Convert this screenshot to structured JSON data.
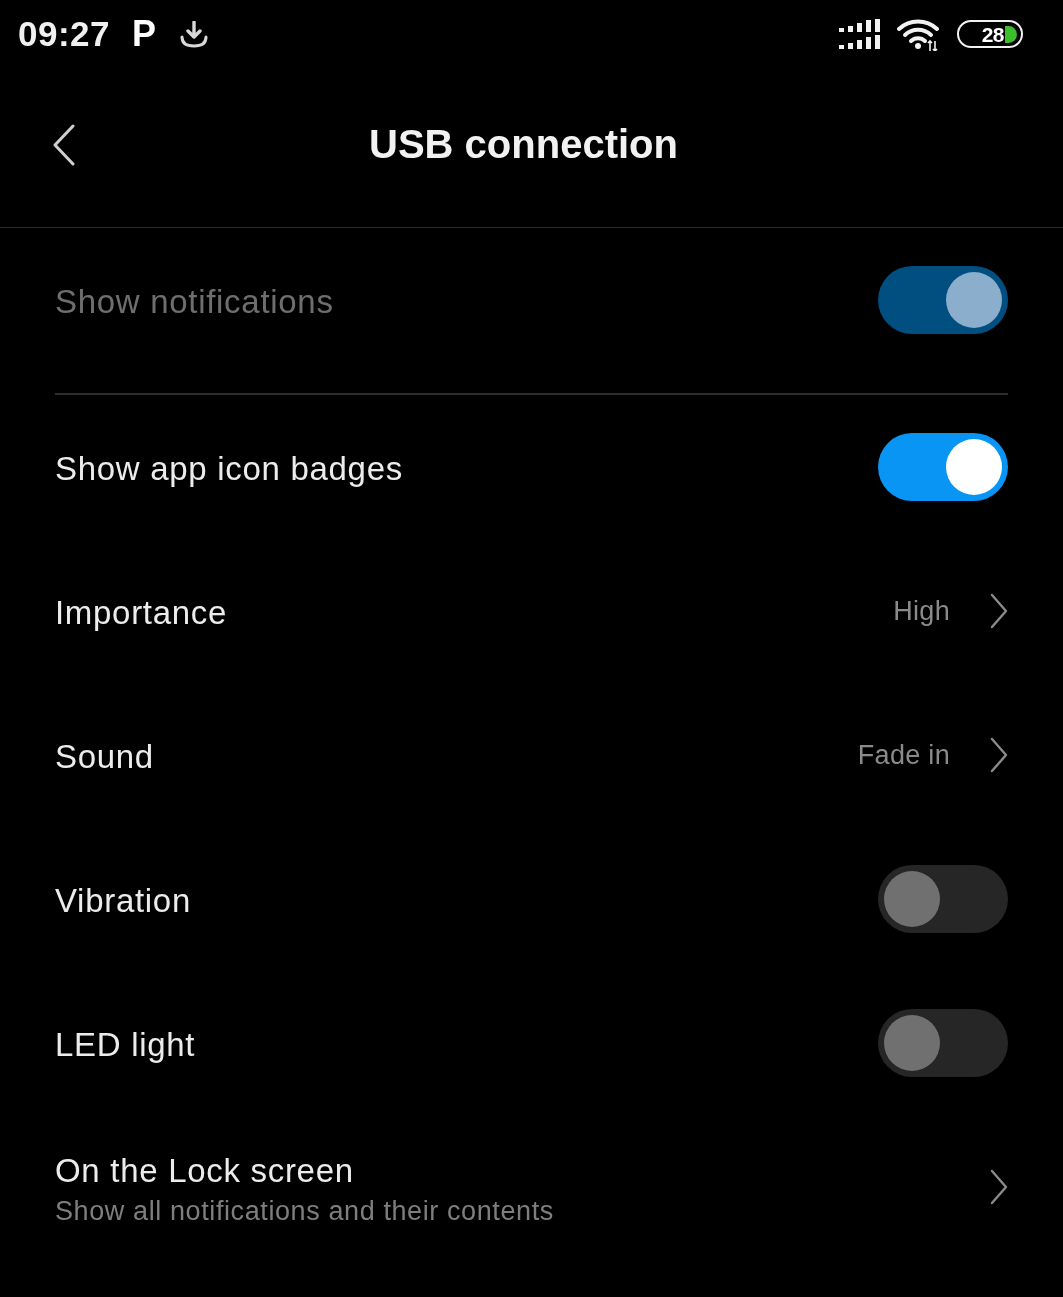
{
  "status_bar": {
    "time": "09:27",
    "app_icon": "P",
    "battery": "28"
  },
  "header": {
    "title": "USB connection"
  },
  "sections": [
    {
      "items": [
        {
          "kind": "toggle",
          "label": "Show notifications",
          "on": true,
          "disabled": true
        }
      ]
    },
    {
      "items": [
        {
          "kind": "toggle",
          "label": "Show app icon badges",
          "on": true,
          "disabled": false
        },
        {
          "kind": "link",
          "label": "Importance",
          "value": "High",
          "disabled": false
        },
        {
          "kind": "link",
          "label": "Sound",
          "value": "Fade in",
          "disabled": false
        },
        {
          "kind": "toggle",
          "label": "Vibration",
          "on": false,
          "disabled": false
        },
        {
          "kind": "toggle",
          "label": "LED light",
          "on": false,
          "disabled": false
        },
        {
          "kind": "link",
          "label": "On the Lock screen",
          "subtitle": "Show all notifications and their contents",
          "disabled": false
        }
      ]
    }
  ]
}
